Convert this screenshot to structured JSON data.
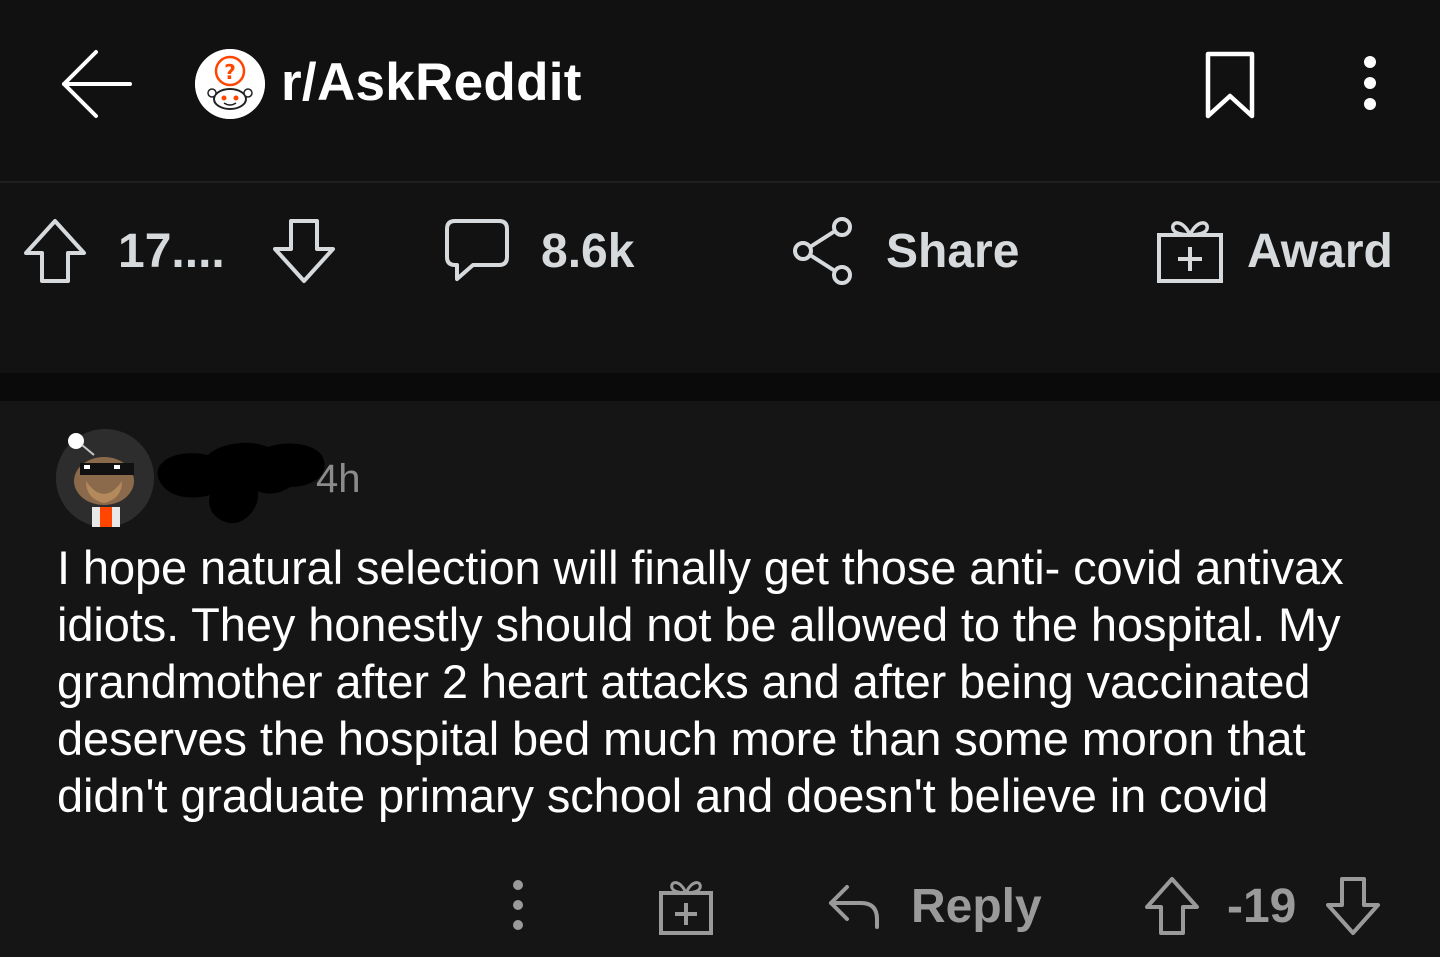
{
  "header": {
    "subreddit": "r/AskReddit"
  },
  "post_actions": {
    "score": "17....",
    "comments": "8.6k",
    "share": "Share",
    "award": "Award"
  },
  "comment": {
    "time": "4h",
    "body": "I hope natural selection will finally get those anti- covid antivax idiots. They honestly should not be allowed to the hospital. My grandmother after 2 heart attacks and after being vaccinated deserves the hospital bed much more than some moron that didn't graduate primary school and doesn't believe in covid",
    "actions": {
      "reply": "Reply",
      "score": "-19"
    }
  },
  "icons": {
    "back": "arrow-left-icon",
    "subreddit": "askreddit-snoo-icon",
    "bookmark": "bookmark-icon",
    "more": "more-vertical-icon",
    "upvote": "arrow-up-icon",
    "downvote": "arrow-down-icon",
    "comment": "comment-bubble-icon",
    "share": "share-icon",
    "award": "gift-icon",
    "reply": "reply-icon"
  },
  "colors": {
    "background": "#121212",
    "topbar": "#111111",
    "text": "#ffffff",
    "muted": "#9a9a9a",
    "askreddit_orange": "#ff4500"
  }
}
